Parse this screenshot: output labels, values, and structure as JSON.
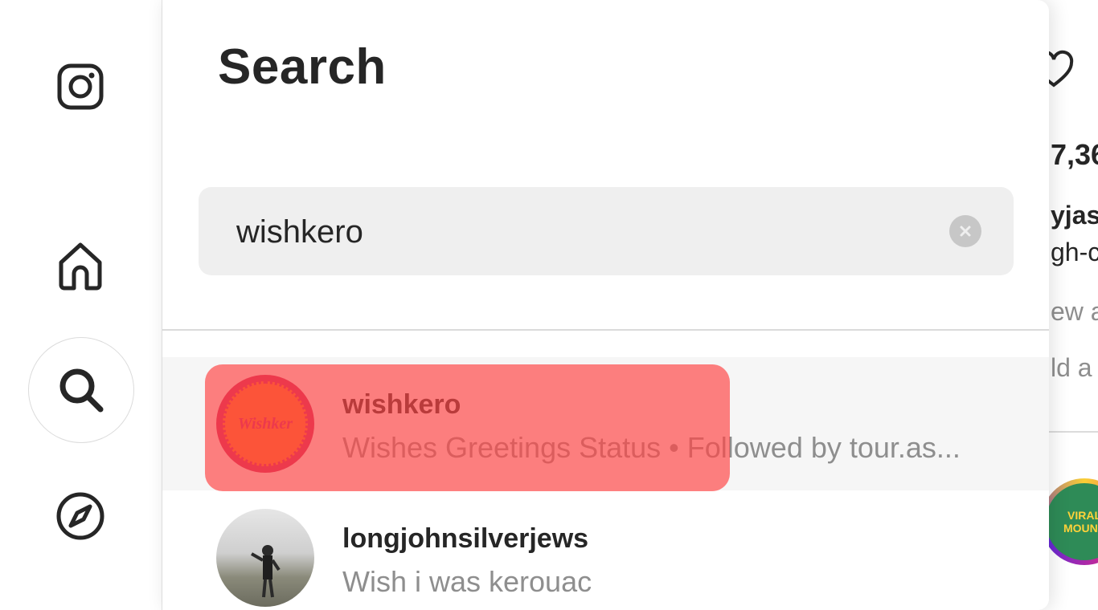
{
  "nav": {
    "items": [
      {
        "name": "instagram-logo-icon"
      },
      {
        "name": "home-icon"
      },
      {
        "name": "search-icon"
      },
      {
        "name": "explore-compass-icon"
      }
    ]
  },
  "search_panel": {
    "title": "Search",
    "search": {
      "value": "wishkero",
      "placeholder": "Search"
    },
    "results": [
      {
        "username": "wishkero",
        "subtitle": "Wishes Greetings Status • Followed by tour.as...",
        "avatar_text": "Wishker"
      },
      {
        "username": "longjohnsilverjews",
        "subtitle": "Wish i was kerouac"
      }
    ]
  },
  "background_page": {
    "likes": "7,36",
    "caption_user": "yjas",
    "caption_text": "gh-c",
    "view_all": "ew a",
    "add_comment": "ld a",
    "badge_text": "VIRAL\nMOUNS"
  },
  "colors": {
    "highlight": "#ff4646",
    "avatar_orange": "#f5731f",
    "avatar_ring": "#c8205a"
  }
}
